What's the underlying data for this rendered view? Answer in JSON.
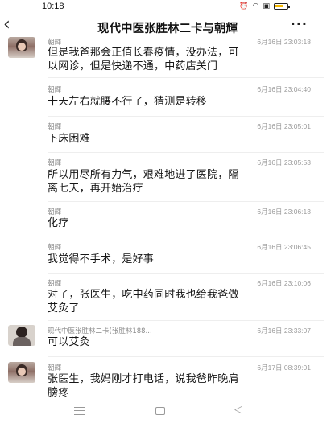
{
  "status_bar": {
    "time": "10:18",
    "icons": [
      "alarm-icon",
      "wifi-icon",
      "sim-icon",
      "battery-icon"
    ]
  },
  "header": {
    "back_icon": "‹",
    "title": "现代中医张胜林二卡与朝輝",
    "more_icon": "···"
  },
  "messages": [
    {
      "sender": "朝輝",
      "time": "6月16日 23:03:18",
      "avatar": "woman-avatar",
      "text_lines": [
        "但是我爸那会正值长春疫情，没办法，可",
        "以网诊，但是快递不通，中药店关门"
      ]
    },
    {
      "sender": "朝輝",
      "time": "6月16日 23:04:40",
      "avatar": "none",
      "text_lines": [
        "十天左右就腰不行了，猜测是转移"
      ]
    },
    {
      "sender": "朝輝",
      "time": "6月16日 23:05:01",
      "avatar": "none",
      "text_lines": [
        "下床困难"
      ]
    },
    {
      "sender": "朝輝",
      "time": "6月16日 23:05:53",
      "avatar": "none",
      "text_lines": [
        "所以用尽所有力气，艰难地进了医院，隔",
        "离七天，再开始治疗"
      ]
    },
    {
      "sender": "朝輝",
      "time": "6月16日 23:06:13",
      "avatar": "none",
      "text_lines": [
        "化疗"
      ]
    },
    {
      "sender": "朝輝",
      "time": "6月16日 23:06:45",
      "avatar": "none",
      "text_lines": [
        "我觉得不手术，是好事"
      ]
    },
    {
      "sender": "朝輝",
      "time": "6月16日 23:10:06",
      "avatar": "none",
      "text_lines": [
        "对了，张医生，吃中药同时我也给我爸做",
        "艾灸了"
      ]
    },
    {
      "sender": "现代中医张胜林二卡(张胜林188...",
      "time": "6月16日 23:33:07",
      "avatar": "doctor-avatar",
      "text_lines": [
        "可以艾灸"
      ]
    },
    {
      "sender": "朝輝",
      "time": "6月17日 08:39:01",
      "avatar": "woman-avatar",
      "text_lines": [
        "张医生，我妈刚才打电话，说我爸昨晚肩",
        "膀疼"
      ]
    }
  ],
  "nav_bar": {
    "icons": [
      "menu-icon",
      "home-icon",
      "back-triangle-icon"
    ],
    "back_glyph": "◁"
  }
}
